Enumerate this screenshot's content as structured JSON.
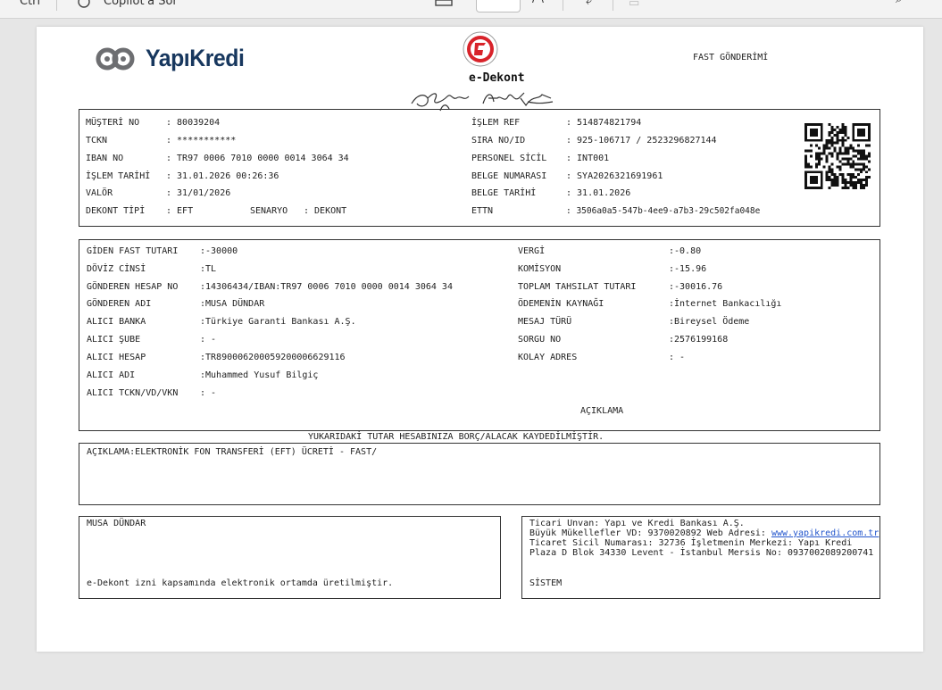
{
  "toolbar": {
    "tab_label": "Copilot'a Sor",
    "left_label": "Ctrl"
  },
  "header": {
    "brand": "YapıKredi",
    "doc_title": "e-Dekont",
    "doc_type": "FAST GÖNDERİMİ"
  },
  "info_left": [
    {
      "label": "MÜŞTERİ NO",
      "value": ": 80039204"
    },
    {
      "label": "TCKN",
      "value": ": ***********"
    },
    {
      "label": "IBAN NO",
      "value": ": TR97 0006 7010 0000 0014 3064 34"
    },
    {
      "label": "İŞLEM TARİHİ",
      "value": ": 31.01.2026 00:26:36"
    },
    {
      "label": "VALÖR",
      "value": ": 31/01/2026"
    },
    {
      "label": "DEKONT TİPİ",
      "value": ": EFT"
    }
  ],
  "scenario": {
    "label": "SENARYO",
    "value": ": DEKONT"
  },
  "info_right": [
    {
      "label": "İŞLEM REF",
      "value": ": 514874821794"
    },
    {
      "label": "SIRA NO/ID",
      "value": ": 925-106717 / 2523296827144"
    },
    {
      "label": "PERSONEL SİCİL",
      "value": ": INT001"
    },
    {
      "label": "BELGE NUMARASI",
      "value": ": SYA2026321691961"
    },
    {
      "label": "BELGE TARİHİ",
      "value": ": 31.01.2026"
    },
    {
      "label": "ETTN",
      "value": ": 3506a0a5-547b-4ee9-a7b3-29c502fa048e"
    }
  ],
  "transfer_left": [
    {
      "label": "GİDEN FAST TUTARI",
      "value": ":-30000"
    },
    {
      "label": "DÖVİZ CİNSİ",
      "value": ":TL"
    },
    {
      "label": "GÖNDEREN HESAP NO",
      "value": ":14306434/IBAN:TR97 0006 7010 0000 0014 3064 34"
    },
    {
      "label": "GÖNDEREN ADI",
      "value": ":MUSA DÜNDAR"
    },
    {
      "label": "ALICI BANKA",
      "value": ":Türkiye Garanti Bankası A.Ş."
    },
    {
      "label": "ALICI ŞUBE",
      "value": ": -"
    },
    {
      "label": "ALICI HESAP",
      "value": ":TR890006200059200006629116"
    },
    {
      "label": "ALICI ADI",
      "value": ":Muhammed Yusuf Bilgiç"
    },
    {
      "label": "ALICI TCKN/VD/VKN",
      "value": ": -"
    }
  ],
  "transfer_right": [
    {
      "label": "VERGİ",
      "value": ":-0.80"
    },
    {
      "label": "KOMİSYON",
      "value": ":-15.96"
    },
    {
      "label": "TOPLAM TAHSILAT TUTARI",
      "value": ":-30016.76"
    },
    {
      "label": "ÖDEMENİN KAYNAĞI",
      "value": ":İnternet Bankacılığı"
    },
    {
      "label": "MESAJ TÜRÜ",
      "value": ":Bireysel Ödeme"
    },
    {
      "label": "SORGU NO",
      "value": ":2576199168"
    },
    {
      "label": "KOLAY ADRES",
      "value": ": -"
    }
  ],
  "aciklama_heading": "AÇIKLAMA",
  "notice": "YUKARIDAKİ TUTAR HESABINIZA BORÇ/ALACAK KAYDEDİLMİŞTİR.",
  "description": "AÇIKLAMA:ELEKTRONİK FON TRANSFERİ (EFT) ÜCRETİ - FAST/",
  "footer_left": {
    "name": "MUSA DÜNDAR",
    "note": "e-Dekont izni kapsamında elektronik ortamda üretilmiştir."
  },
  "footer_right": {
    "line1": "Ticari Unvan: Yapı ve Kredi Bankası A.Ş.",
    "line2_prefix": "Büyük Mükellefler VD: 9370020892 Web Adresi: ",
    "link": "www.yapikredi.com.tr",
    "line3": "Ticaret Sicil Numarası: 32736 İşletmenin Merkezi: Yapı Kredi",
    "line4": "Plaza D Blok 34330 Levent - İstanbul Mersis No: 0937002089200741",
    "system": "SİSTEM"
  },
  "colors": {
    "brand_blue": "#17375e",
    "link_blue": "#2255cc",
    "emblem_red": "#d8232a"
  }
}
